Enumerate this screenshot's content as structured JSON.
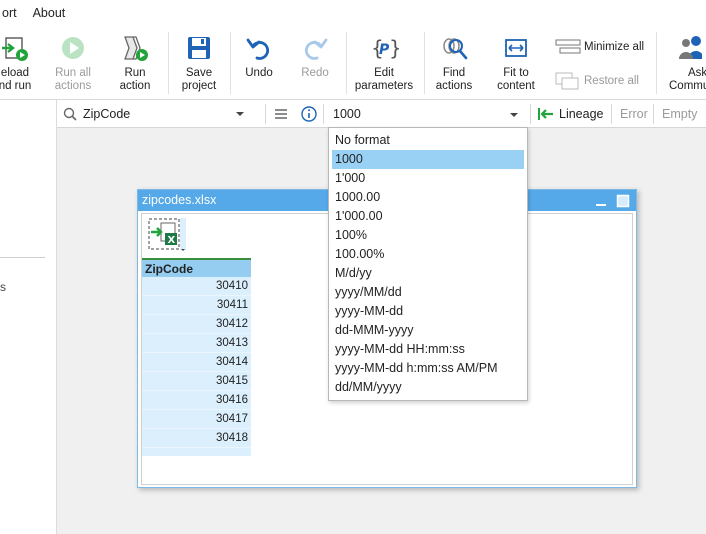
{
  "menu": {
    "items": [
      "ort",
      "About"
    ]
  },
  "ribbon": {
    "reload_run": {
      "line1": "eload",
      "line2": "nd run"
    },
    "run_all": {
      "line1": "Run all",
      "line2": "actions"
    },
    "run_action": {
      "line1": "Run",
      "line2": "action"
    },
    "save_project": {
      "line1": "Save",
      "line2": "project"
    },
    "undo": {
      "label": "Undo"
    },
    "redo": {
      "label": "Redo"
    },
    "edit_parameters": {
      "line1": "Edit",
      "line2": "parameters"
    },
    "find_actions": {
      "line1": "Find",
      "line2": "actions"
    },
    "fit_content": {
      "line1": "Fit to",
      "line2": "content"
    },
    "minimize_all": {
      "label": "Minimize all"
    },
    "restore_all": {
      "label": "Restore all"
    },
    "ask_community": {
      "line1": "Ask",
      "line2": "Commu"
    }
  },
  "left_panel": {
    "fragment": "s"
  },
  "toolbar": {
    "search_value": "ZipCode",
    "format_value": "1000",
    "lineage_label": "Lineage",
    "error_label": "Error",
    "empty_label": "Empty"
  },
  "dropdown": {
    "options": [
      "No format",
      "1000",
      "1'000",
      "1000.00",
      "1'000.00",
      "100%",
      "100.00%",
      "M/d/yy",
      "yyyy/MM/dd",
      "yyyy-MM-dd",
      "dd-MMM-yyyy",
      "yyyy-MM-dd HH:mm:ss",
      "yyyy-MM-dd h:mm:ss AM/PM",
      "dd/MM/yyyy"
    ],
    "selected": "1000"
  },
  "doc_window": {
    "title": "zipcodes.xlsx",
    "column_header": "ZipCode",
    "rows": [
      "30410",
      "30411",
      "30412",
      "30413",
      "30414",
      "30415",
      "30416",
      "30417",
      "30418"
    ]
  },
  "colors": {
    "accent": "#55a9e8",
    "selection": "#99d1f5",
    "cell_bg": "#dbeffc",
    "run_green": "#22a33b",
    "save_blue": "#1e63b5"
  }
}
